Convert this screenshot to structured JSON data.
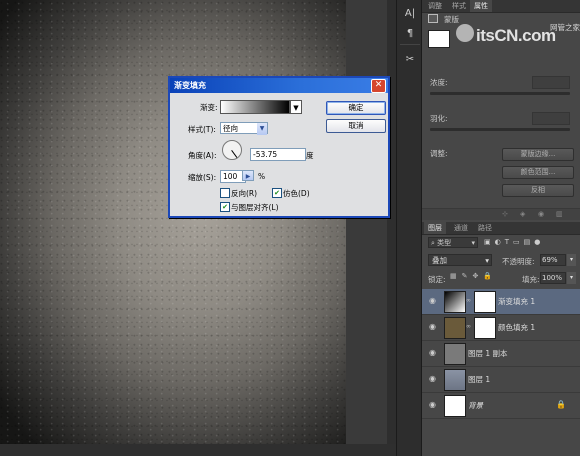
{
  "dialog": {
    "title": "渐变填充",
    "gradient_label": "渐变:",
    "style_label": "样式(T):",
    "style_value": "径向",
    "angle_label": "角度(A):",
    "angle_value": "-53.75",
    "angle_unit": "度",
    "scale_label": "缩放(S):",
    "scale_value": "100",
    "scale_unit": "%",
    "reverse_label": "反向(R)",
    "reverse_checked": false,
    "dither_label": "仿色(D)",
    "dither_checked": true,
    "align_label": "与图层对齐(L)",
    "align_checked": true,
    "ok_label": "确定",
    "cancel_label": "取消",
    "close_glyph": "✕"
  },
  "tools": {
    "character_glyph": "A|",
    "paragraph_glyph": "¶",
    "tools_glyph": "✂"
  },
  "properties": {
    "tabs": [
      "调整",
      "样式",
      "属性"
    ],
    "mask_label": "蒙版",
    "density_label": "浓度:",
    "feather_label": "羽化:",
    "adjust_label": "调整:",
    "mask_edge_button": "蒙版边缘...",
    "color_range_button": "颜色范围...",
    "invert_button": "反相"
  },
  "watermark": {
    "brand": "itsCN.com",
    "sub": "网管之家"
  },
  "layers": {
    "tabs": [
      "图层",
      "通道",
      "路径"
    ],
    "filter_kind": "类型",
    "blend_mode": "叠加",
    "opacity_label": "不透明度:",
    "opacity_value": "69%",
    "lock_label": "锁定:",
    "fill_label": "填充:",
    "fill_value": "100%",
    "items": [
      {
        "name": "渐变填充 1",
        "selected": true
      },
      {
        "name": "颜色填充 1",
        "selected": false
      },
      {
        "name": "图层 1 副本",
        "selected": false
      },
      {
        "name": "图层 1",
        "selected": false
      },
      {
        "name": "背景",
        "selected": false,
        "locked": true
      }
    ]
  }
}
